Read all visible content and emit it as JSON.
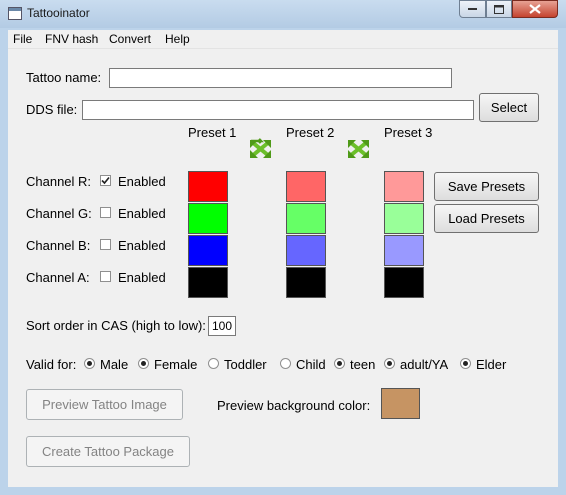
{
  "window": {
    "title": "Tattooinator"
  },
  "menu": [
    "File",
    "FNV hash",
    "Convert",
    "Help"
  ],
  "form": {
    "tattoo_name_label": "Tattoo name:",
    "tattoo_name_value": "",
    "dds_file_label": "DDS file:",
    "dds_file_value": "",
    "select_label": "Select"
  },
  "presets": {
    "headers": [
      "Preset 1",
      "Preset 2",
      "Preset 3"
    ],
    "colors": [
      [
        "#ff0000",
        "#00ff00",
        "#0000ff",
        "#000000"
      ],
      [
        "#ff6666",
        "#66ff66",
        "#6666ff",
        "#000000"
      ],
      [
        "#ff9999",
        "#99ff99",
        "#9999ff",
        "#000000"
      ]
    ],
    "save_label": "Save Presets",
    "load_label": "Load Presets"
  },
  "channels": [
    {
      "label": "Channel R:",
      "enabled_label": "Enabled",
      "checked": true
    },
    {
      "label": "Channel G:",
      "enabled_label": "Enabled",
      "checked": false
    },
    {
      "label": "Channel B:",
      "enabled_label": "Enabled",
      "checked": false
    },
    {
      "label": "Channel A:",
      "enabled_label": "Enabled",
      "checked": false
    }
  ],
  "sort": {
    "label": "Sort order in CAS (high to low):",
    "value": "100"
  },
  "valid_for": {
    "label": "Valid for:",
    "options": [
      {
        "label": "Male",
        "selected": true
      },
      {
        "label": "Female",
        "selected": true
      },
      {
        "label": "Toddler",
        "selected": false
      },
      {
        "label": "Child",
        "selected": false
      },
      {
        "label": "teen",
        "selected": true
      },
      {
        "label": "adult/YA",
        "selected": true
      },
      {
        "label": "Elder",
        "selected": true
      }
    ]
  },
  "preview": {
    "button_label": "Preview Tattoo Image",
    "bg_label": "Preview background color:",
    "bg_color": "#c69463"
  },
  "create_label": "Create Tattoo Package"
}
